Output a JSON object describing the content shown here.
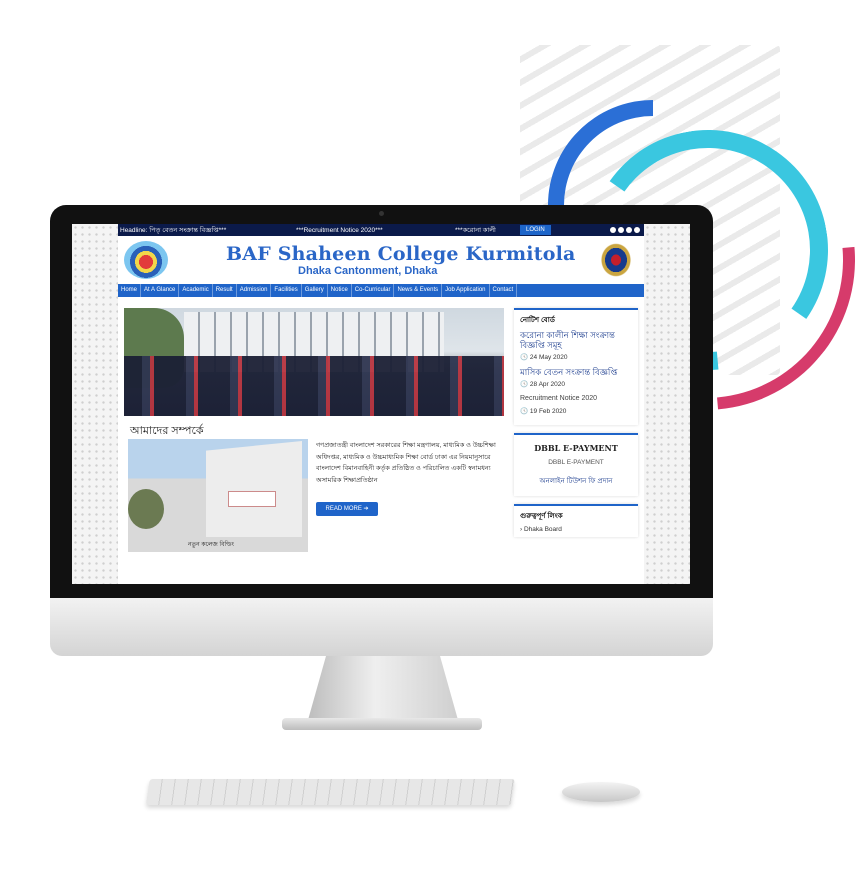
{
  "topbar": {
    "headline": "Headline: পিতৃ বেতন সংক্রান্ত বিজ্ঞপ্তি***",
    "notice1": "***Recruitment Notice 2020***",
    "notice2": "***করোনা কালী",
    "login": "LOGIN"
  },
  "header": {
    "title": "BAF Shaheen College Kurmitola",
    "subtitle": "Dhaka Cantonment, Dhaka"
  },
  "nav": {
    "items": [
      "Home",
      "At A Glance",
      "Academic",
      "Result",
      "Admission",
      "Facilities",
      "Gallery",
      "Notice",
      "Co-Curricular",
      "News & Events",
      "Job Application",
      "Contact"
    ]
  },
  "about": {
    "heading": "আমাদের সম্পর্কে",
    "text": "গণপ্রজাতন্ত্রী বাংলাদেশ সরকারের শিক্ষা মন্ত্রণালয়, মাধ্যমিক ও উচ্চশিক্ষা অধিদপ্তর, মাধ্যমিক ও উচ্চমাধ্যমিক শিক্ষা বোর্ড ঢাকা এর নিয়মানুসারে বাংলাদেশ বিমানবাহিনী কর্তৃক প্রতিষ্ঠিত ও পরিচালিত একটি স্বনামধন্য অসামরিক শিক্ষাপ্রতিষ্ঠান",
    "image_caption": "নতুন কলেজ বিল্ডিং",
    "read_more": "READ MORE ➔"
  },
  "sidebar": {
    "notice_board": {
      "title": "নোটিশ বোর্ড",
      "notices": [
        {
          "title": "করোনা কালীন শিক্ষা সংক্রান্ত বিজ্ঞপ্তি সমূহ",
          "date": "24 May 2020"
        },
        {
          "title": "মাসিক বেতন সংক্রান্ত বিজ্ঞপ্তি",
          "date": "28 Apr 2020"
        },
        {
          "title": "Recruitment Notice 2020",
          "date": "19 Feb 2020"
        }
      ]
    },
    "dbbl": {
      "title": "DBBL E-PAYMENT",
      "subtitle": "DBBL E-PAYMENT",
      "link": "অনলাইন টিউশন ফি প্রদান"
    },
    "important_links": {
      "title": "গুরুত্বপূর্ণ লিংক",
      "items": [
        "Dhaka Board"
      ]
    }
  }
}
